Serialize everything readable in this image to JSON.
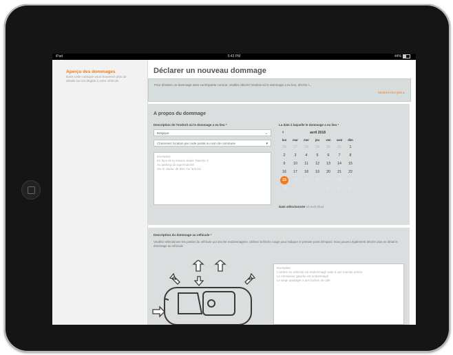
{
  "status": {
    "left": "iPad",
    "time": "5:43 PM",
    "battery": "44%"
  },
  "sidebar": {
    "title": "Aperçu des dommages",
    "description": "Dans cette rubrique vous trouverez plus de détails sur les dégâts à votre véhicule"
  },
  "page": {
    "title": "Déclarer un nouveau dommage"
  },
  "intro": {
    "text": "Pour déclarer un dommage sans contrepartie connue, veuillez décrire l'endroit où le dommage a eu lieu, décrire l...",
    "more_link": "Montrez-moi plus ▸"
  },
  "section1": {
    "title": "A propos du dommage",
    "location": {
      "label": "Description de l'endroit où le dommage a eu lieu",
      "required": "*",
      "country_value": "Belgique",
      "locality_value": "Choisissez location par code postal ou nom de commune",
      "textarea_placeholder": "Exemples:\nEn face de la maison située 'Marché 1'\nAu parking du supermarché\nSur le viaduc de Biez sur la E411"
    },
    "date": {
      "label": "La date à laquelle le dommage a eu lieu",
      "required": "*",
      "month_label": "avril 2018",
      "prev_icon": "chevron-left-icon",
      "weekdays": [
        "lun",
        "mar",
        "mer",
        "jeu",
        "ven",
        "sam",
        "dim"
      ],
      "weeks": [
        [
          {
            "d": "26",
            "dim": true
          },
          {
            "d": "27",
            "dim": true
          },
          {
            "d": "28",
            "dim": true
          },
          {
            "d": "29",
            "dim": true
          },
          {
            "d": "30",
            "dim": true
          },
          {
            "d": "31",
            "dim": true
          },
          {
            "d": "1"
          }
        ],
        [
          {
            "d": "2"
          },
          {
            "d": "3"
          },
          {
            "d": "4"
          },
          {
            "d": "5"
          },
          {
            "d": "6"
          },
          {
            "d": "7"
          },
          {
            "d": "8"
          }
        ],
        [
          {
            "d": "9"
          },
          {
            "d": "10"
          },
          {
            "d": "11"
          },
          {
            "d": "12"
          },
          {
            "d": "13"
          },
          {
            "d": "14"
          },
          {
            "d": "15"
          }
        ],
        [
          {
            "d": "16"
          },
          {
            "d": "17"
          },
          {
            "d": "18"
          },
          {
            "d": "19"
          },
          {
            "d": "20"
          },
          {
            "d": "21"
          },
          {
            "d": "22"
          }
        ],
        [
          {
            "d": "23",
            "selected": true
          },
          {
            "d": "24",
            "faint": true
          },
          {
            "d": "25",
            "faint": true
          },
          {
            "d": "26",
            "faint": true
          },
          {
            "d": "27",
            "faint": true
          },
          {
            "d": "28",
            "faint": true
          },
          {
            "d": "29",
            "faint": true
          }
        ],
        [
          {
            "d": "30",
            "faint": true
          },
          {
            "d": "1",
            "faint": true
          },
          {
            "d": "2",
            "faint": true
          },
          {
            "d": "3",
            "faint": true
          },
          {
            "d": "4",
            "faint": true
          },
          {
            "d": "5",
            "faint": true
          },
          {
            "d": "6",
            "faint": true
          }
        ]
      ],
      "selected_label": "Date sélectionnée",
      "selected_value": "23 avril 2018"
    }
  },
  "section2": {
    "label": "Description du dommage au véhicule",
    "required": "*",
    "description": "Veuillez sélectionner les parties du véhicule qui ont été endommagées. Utilisez la flèche rouge pour indiquer le premier point d'impact. Vous pouvez également décrire plus en détail le dommage au véhicule",
    "textarea_placeholder": "Exemples:\nL'arrière du véhicule est endommagé suite à une marche arrière\nLe rétroviseur gauche est endommagé\nLe siège passager a des taches de café"
  },
  "colors": {
    "accent": "#ef7a1b",
    "panel": "#dadedf",
    "required": "#d9361e"
  }
}
